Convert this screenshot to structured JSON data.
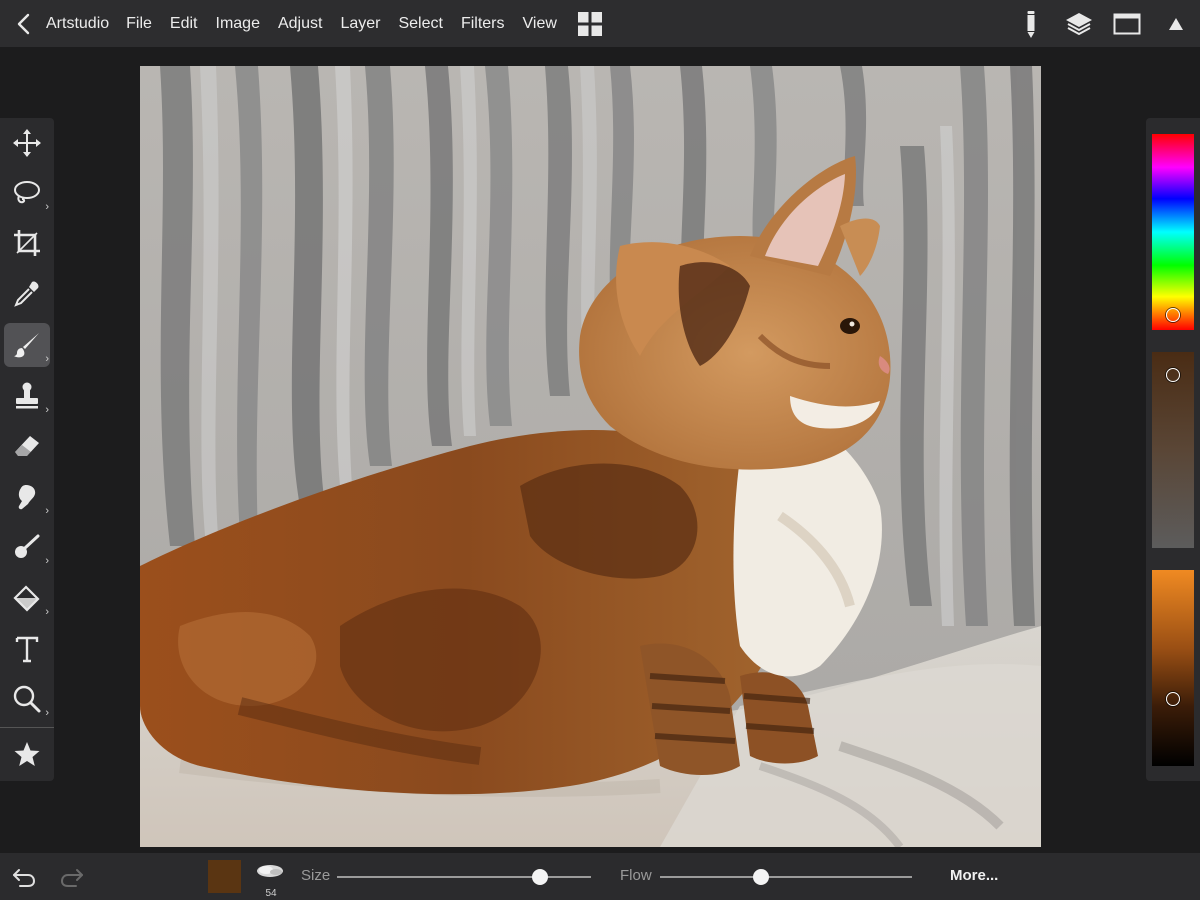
{
  "menu": {
    "app_name": "Artstudio",
    "items": [
      "File",
      "Edit",
      "Image",
      "Adjust",
      "Layer",
      "Select",
      "Filters",
      "View"
    ]
  },
  "top_right_icons": [
    "pencil-icon",
    "layers-icon",
    "window-icon",
    "triangle-up-icon"
  ],
  "tools": [
    {
      "name": "move-tool",
      "icon": "move-arrows-icon",
      "has_submenu": false
    },
    {
      "name": "lasso-tool",
      "icon": "lasso-icon",
      "has_submenu": true
    },
    {
      "name": "crop-tool",
      "icon": "crop-icon",
      "has_submenu": false
    },
    {
      "name": "eyedropper-tool",
      "icon": "eyedropper-icon",
      "has_submenu": false
    },
    {
      "name": "brush-tool",
      "icon": "brush-icon",
      "has_submenu": true,
      "active": true
    },
    {
      "name": "stamp-tool",
      "icon": "stamp-icon",
      "has_submenu": true
    },
    {
      "name": "eraser-tool",
      "icon": "eraser-icon",
      "has_submenu": false
    },
    {
      "name": "smudge-tool",
      "icon": "smudge-icon",
      "has_submenu": true
    },
    {
      "name": "dodge-tool",
      "icon": "dodge-icon",
      "has_submenu": true
    },
    {
      "name": "fill-tool",
      "icon": "bucket-icon",
      "has_submenu": true
    },
    {
      "name": "text-tool",
      "icon": "text-icon",
      "has_submenu": false
    },
    {
      "name": "zoom-tool",
      "icon": "magnifier-icon",
      "has_submenu": true
    },
    {
      "name": "favorites-tool",
      "icon": "star-icon",
      "has_submenu": false
    }
  ],
  "colors": {
    "current": "#5a3512",
    "accent_orange": "#f08a22"
  },
  "bottom": {
    "brush_size_number": "54",
    "size_label": "Size",
    "size_value": 0.8,
    "flow_label": "Flow",
    "flow_value": 0.4,
    "more_label": "More..."
  }
}
